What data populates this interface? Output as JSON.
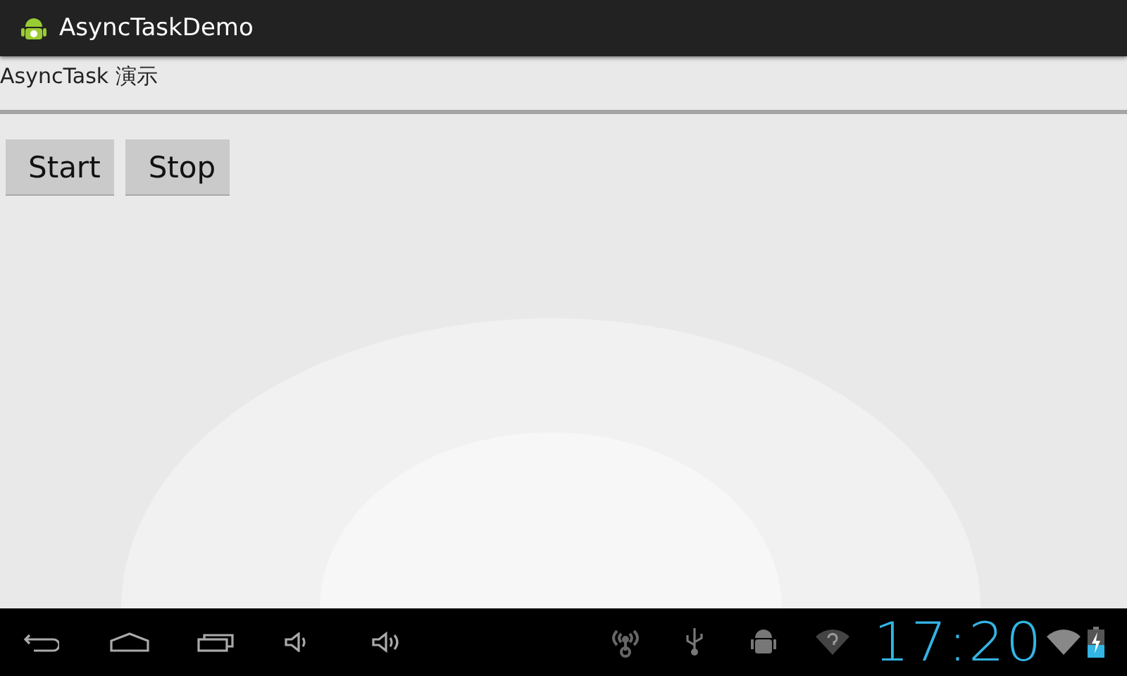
{
  "action_bar": {
    "title": "AsyncTaskDemo"
  },
  "content": {
    "label": "AsyncTask 演示",
    "buttons": [
      "Start",
      "Stop"
    ]
  },
  "system_bar": {
    "clock": "17:20"
  }
}
